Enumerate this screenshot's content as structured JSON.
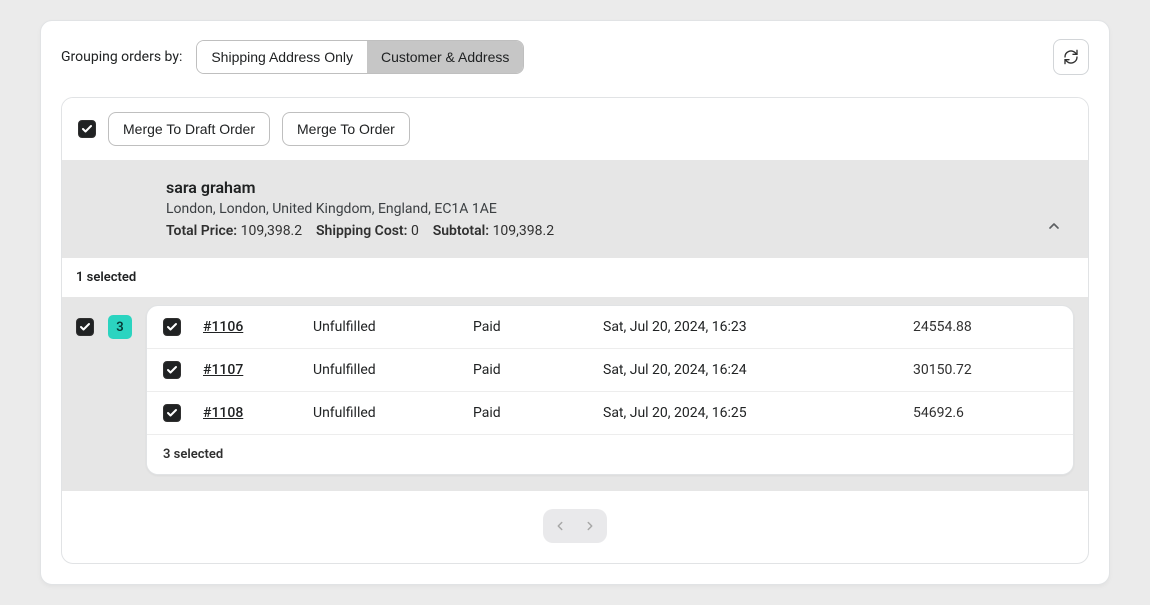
{
  "header": {
    "grouping_label": "Grouping orders by:",
    "seg_options": [
      "Shipping Address Only",
      "Customer & Address"
    ],
    "seg_active_index": 1
  },
  "actions": {
    "merge_draft": "Merge To Draft Order",
    "merge_order": "Merge To Order"
  },
  "group": {
    "customer_name": "sara graham",
    "address": "London, London, United Kingdom, England, EC1A 1AE",
    "total_price_label": "Total Price:",
    "total_price": "109,398.2",
    "shipping_label": "Shipping Cost:",
    "shipping_cost": "0",
    "subtotal_label": "Subtotal:",
    "subtotal": "109,398.2"
  },
  "selection": {
    "outer_selected_text": "1 selected",
    "badge_count": "3",
    "inner_selected_text": "3 selected"
  },
  "orders": [
    {
      "id": "#1106",
      "fulfillment": "Unfulfilled",
      "payment": "Paid",
      "date": "Sat, Jul 20, 2024, 16:23",
      "amount": "24554.88"
    },
    {
      "id": "#1107",
      "fulfillment": "Unfulfilled",
      "payment": "Paid",
      "date": "Sat, Jul 20, 2024, 16:24",
      "amount": "30150.72"
    },
    {
      "id": "#1108",
      "fulfillment": "Unfulfilled",
      "payment": "Paid",
      "date": "Sat, Jul 20, 2024, 16:25",
      "amount": "54692.6"
    }
  ]
}
